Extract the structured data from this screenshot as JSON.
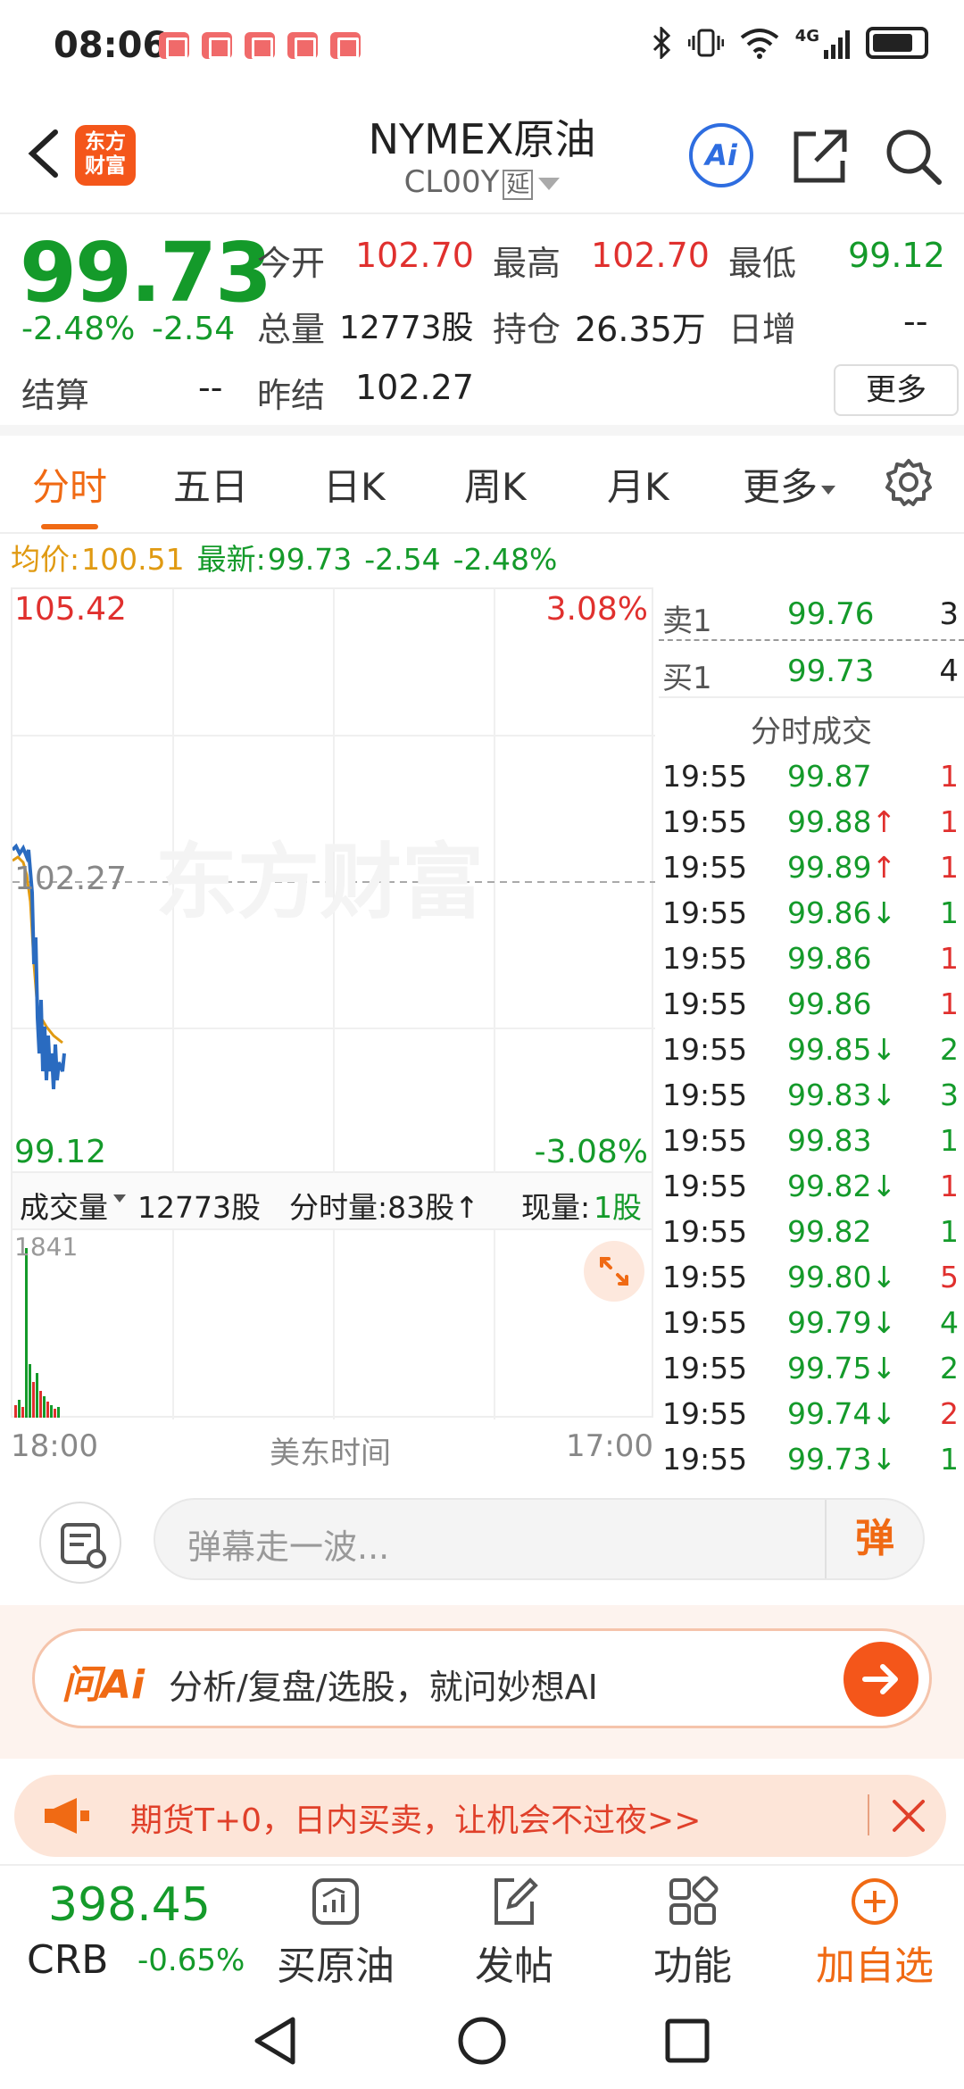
{
  "status_bar": {
    "time": "08:06",
    "signal": "4G"
  },
  "header": {
    "logo_text_top": "东方",
    "logo_text_bottom": "财富",
    "title": "NYMEX原油",
    "code": "CL00Y",
    "code_tag": "延",
    "ai_label": "Ai"
  },
  "quote": {
    "price": "99.73",
    "change_pct": "-2.48%",
    "change": "-2.54",
    "open_label": "今开",
    "open": "102.70",
    "high_label": "最高",
    "high": "102.70",
    "low_label": "最低",
    "low": "99.12",
    "volume_label": "总量",
    "volume": "12773股",
    "oi_label": "持仓",
    "oi": "26.35万",
    "daily_inc_label": "日增",
    "daily_inc": "--",
    "settle_label": "结算",
    "settle": "--",
    "prev_settle_label": "昨结",
    "prev_settle": "102.27",
    "more_label": "更多"
  },
  "tabs": [
    {
      "label": "分时",
      "active": true
    },
    {
      "label": "五日"
    },
    {
      "label": "日K"
    },
    {
      "label": "周K"
    },
    {
      "label": "月K"
    },
    {
      "label": "更多"
    }
  ],
  "info_line": {
    "avg_label": "均价:",
    "avg": "100.51",
    "latest_label": "最新:",
    "latest": "99.73",
    "change": "-2.54",
    "change_pct": "-2.48%"
  },
  "chart": {
    "high_price": "105.42",
    "high_pct": "3.08%",
    "base_price": "102.27",
    "low_price": "99.12",
    "low_pct": "-3.08%",
    "watermark": "东方财富",
    "volume_selector": "成交量",
    "volume_total": "12773股",
    "minute_volume": "分时量:83股↑",
    "current_volume_label": "现量:",
    "current_volume": "1股",
    "vol_max": "1841",
    "axis_start": "18:00",
    "axis_center": "美东时间",
    "axis_end": "17:00"
  },
  "order_book": {
    "ask_label": "卖1",
    "ask_price": "99.76",
    "ask_qty": "3",
    "bid_label": "买1",
    "bid_price": "99.73",
    "bid_qty": "4",
    "ticks_title": "分时成交",
    "ticks": [
      {
        "time": "19:55",
        "price": "99.87",
        "qty": "1",
        "qcolor": "red"
      },
      {
        "time": "19:55",
        "price": "99.88↑",
        "qty": "1",
        "qcolor": "red"
      },
      {
        "time": "19:55",
        "price": "99.89↑",
        "qty": "1",
        "qcolor": "red"
      },
      {
        "time": "19:55",
        "price": "99.86↓",
        "qty": "1",
        "qcolor": "green"
      },
      {
        "time": "19:55",
        "price": "99.86",
        "qty": "1",
        "qcolor": "red"
      },
      {
        "time": "19:55",
        "price": "99.86",
        "qty": "1",
        "qcolor": "red"
      },
      {
        "time": "19:55",
        "price": "99.85↓",
        "qty": "2",
        "qcolor": "green"
      },
      {
        "time": "19:55",
        "price": "99.83↓",
        "qty": "3",
        "qcolor": "green"
      },
      {
        "time": "19:55",
        "price": "99.83",
        "qty": "1",
        "qcolor": "green"
      },
      {
        "time": "19:55",
        "price": "99.82↓",
        "qty": "1",
        "qcolor": "red"
      },
      {
        "time": "19:55",
        "price": "99.82",
        "qty": "1",
        "qcolor": "green"
      },
      {
        "time": "19:55",
        "price": "99.80↓",
        "qty": "5",
        "qcolor": "red"
      },
      {
        "time": "19:55",
        "price": "99.79↓",
        "qty": "4",
        "qcolor": "green"
      },
      {
        "time": "19:55",
        "price": "99.75↓",
        "qty": "2",
        "qcolor": "green"
      },
      {
        "time": "19:55",
        "price": "99.74↓",
        "qty": "2",
        "qcolor": "red"
      },
      {
        "time": "19:55",
        "price": "99.73↓",
        "qty": "1",
        "qcolor": "green"
      }
    ]
  },
  "danmaku": {
    "placeholder": "弹幕走一波...",
    "button": "弹"
  },
  "ai_bar": {
    "brand": "问Ai",
    "text": "分析/复盘/选股，就问妙想AI"
  },
  "promo": {
    "text": "期货T+0，日内买卖，让机会不过夜>>"
  },
  "bottom_nav": {
    "index_price": "398.45",
    "index_name": "CRB",
    "index_change": "-0.65%",
    "items": [
      {
        "label": "买原油",
        "icon": "chart-trade-icon"
      },
      {
        "label": "发帖",
        "icon": "edit-post-icon"
      },
      {
        "label": "功能",
        "icon": "grid-icon"
      },
      {
        "label": "加自选",
        "icon": "plus-circle-icon"
      }
    ]
  },
  "colors": {
    "up": "#e0302e",
    "down": "#149a2a",
    "accent": "#f06a14",
    "avg": "#e09a12",
    "line": "#2a6bc0"
  }
}
